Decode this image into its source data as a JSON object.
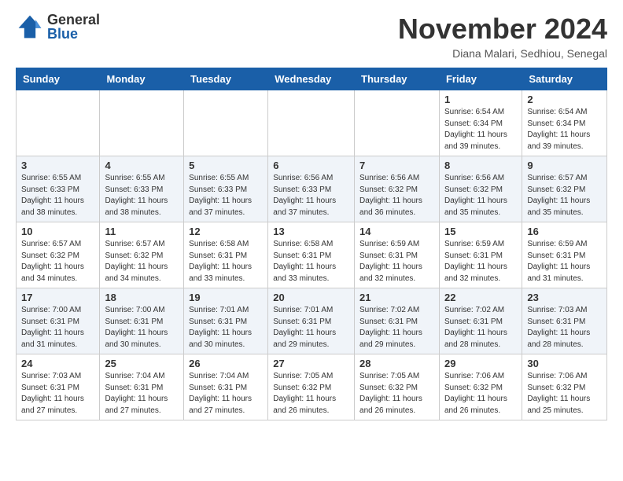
{
  "header": {
    "logo_general": "General",
    "logo_blue": "Blue",
    "month_title": "November 2024",
    "location": "Diana Malari, Sedhiou, Senegal"
  },
  "days_of_week": [
    "Sunday",
    "Monday",
    "Tuesday",
    "Wednesday",
    "Thursday",
    "Friday",
    "Saturday"
  ],
  "weeks": [
    [
      {
        "day": "",
        "info": ""
      },
      {
        "day": "",
        "info": ""
      },
      {
        "day": "",
        "info": ""
      },
      {
        "day": "",
        "info": ""
      },
      {
        "day": "",
        "info": ""
      },
      {
        "day": "1",
        "info": "Sunrise: 6:54 AM\nSunset: 6:34 PM\nDaylight: 11 hours\nand 39 minutes."
      },
      {
        "day": "2",
        "info": "Sunrise: 6:54 AM\nSunset: 6:34 PM\nDaylight: 11 hours\nand 39 minutes."
      }
    ],
    [
      {
        "day": "3",
        "info": "Sunrise: 6:55 AM\nSunset: 6:33 PM\nDaylight: 11 hours\nand 38 minutes."
      },
      {
        "day": "4",
        "info": "Sunrise: 6:55 AM\nSunset: 6:33 PM\nDaylight: 11 hours\nand 38 minutes."
      },
      {
        "day": "5",
        "info": "Sunrise: 6:55 AM\nSunset: 6:33 PM\nDaylight: 11 hours\nand 37 minutes."
      },
      {
        "day": "6",
        "info": "Sunrise: 6:56 AM\nSunset: 6:33 PM\nDaylight: 11 hours\nand 37 minutes."
      },
      {
        "day": "7",
        "info": "Sunrise: 6:56 AM\nSunset: 6:32 PM\nDaylight: 11 hours\nand 36 minutes."
      },
      {
        "day": "8",
        "info": "Sunrise: 6:56 AM\nSunset: 6:32 PM\nDaylight: 11 hours\nand 35 minutes."
      },
      {
        "day": "9",
        "info": "Sunrise: 6:57 AM\nSunset: 6:32 PM\nDaylight: 11 hours\nand 35 minutes."
      }
    ],
    [
      {
        "day": "10",
        "info": "Sunrise: 6:57 AM\nSunset: 6:32 PM\nDaylight: 11 hours\nand 34 minutes."
      },
      {
        "day": "11",
        "info": "Sunrise: 6:57 AM\nSunset: 6:32 PM\nDaylight: 11 hours\nand 34 minutes."
      },
      {
        "day": "12",
        "info": "Sunrise: 6:58 AM\nSunset: 6:31 PM\nDaylight: 11 hours\nand 33 minutes."
      },
      {
        "day": "13",
        "info": "Sunrise: 6:58 AM\nSunset: 6:31 PM\nDaylight: 11 hours\nand 33 minutes."
      },
      {
        "day": "14",
        "info": "Sunrise: 6:59 AM\nSunset: 6:31 PM\nDaylight: 11 hours\nand 32 minutes."
      },
      {
        "day": "15",
        "info": "Sunrise: 6:59 AM\nSunset: 6:31 PM\nDaylight: 11 hours\nand 32 minutes."
      },
      {
        "day": "16",
        "info": "Sunrise: 6:59 AM\nSunset: 6:31 PM\nDaylight: 11 hours\nand 31 minutes."
      }
    ],
    [
      {
        "day": "17",
        "info": "Sunrise: 7:00 AM\nSunset: 6:31 PM\nDaylight: 11 hours\nand 31 minutes."
      },
      {
        "day": "18",
        "info": "Sunrise: 7:00 AM\nSunset: 6:31 PM\nDaylight: 11 hours\nand 30 minutes."
      },
      {
        "day": "19",
        "info": "Sunrise: 7:01 AM\nSunset: 6:31 PM\nDaylight: 11 hours\nand 30 minutes."
      },
      {
        "day": "20",
        "info": "Sunrise: 7:01 AM\nSunset: 6:31 PM\nDaylight: 11 hours\nand 29 minutes."
      },
      {
        "day": "21",
        "info": "Sunrise: 7:02 AM\nSunset: 6:31 PM\nDaylight: 11 hours\nand 29 minutes."
      },
      {
        "day": "22",
        "info": "Sunrise: 7:02 AM\nSunset: 6:31 PM\nDaylight: 11 hours\nand 28 minutes."
      },
      {
        "day": "23",
        "info": "Sunrise: 7:03 AM\nSunset: 6:31 PM\nDaylight: 11 hours\nand 28 minutes."
      }
    ],
    [
      {
        "day": "24",
        "info": "Sunrise: 7:03 AM\nSunset: 6:31 PM\nDaylight: 11 hours\nand 27 minutes."
      },
      {
        "day": "25",
        "info": "Sunrise: 7:04 AM\nSunset: 6:31 PM\nDaylight: 11 hours\nand 27 minutes."
      },
      {
        "day": "26",
        "info": "Sunrise: 7:04 AM\nSunset: 6:31 PM\nDaylight: 11 hours\nand 27 minutes."
      },
      {
        "day": "27",
        "info": "Sunrise: 7:05 AM\nSunset: 6:32 PM\nDaylight: 11 hours\nand 26 minutes."
      },
      {
        "day": "28",
        "info": "Sunrise: 7:05 AM\nSunset: 6:32 PM\nDaylight: 11 hours\nand 26 minutes."
      },
      {
        "day": "29",
        "info": "Sunrise: 7:06 AM\nSunset: 6:32 PM\nDaylight: 11 hours\nand 26 minutes."
      },
      {
        "day": "30",
        "info": "Sunrise: 7:06 AM\nSunset: 6:32 PM\nDaylight: 11 hours\nand 25 minutes."
      }
    ]
  ]
}
